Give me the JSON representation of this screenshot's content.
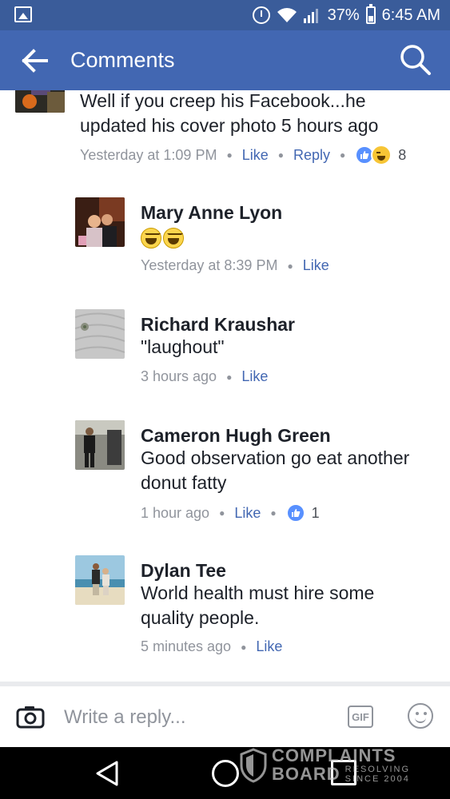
{
  "status_bar": {
    "battery": "37%",
    "time": "6:45 AM"
  },
  "app_bar": {
    "title": "Comments"
  },
  "comments": [
    {
      "name": "",
      "text_lines": [
        "Well if you creep his Facebook...he",
        "updated his cover photo 5 hours ago"
      ],
      "time": "Yesterday at 1:09 PM",
      "like": "Like",
      "reply": "Reply",
      "reactions": [
        "like",
        "haha"
      ],
      "reaction_count": "8"
    },
    {
      "name": "Mary Anne Lyon",
      "emojis": [
        "haha",
        "haha"
      ],
      "time": "Yesterday at 8:39 PM",
      "like": "Like"
    },
    {
      "name": "Richard Kraushar",
      "text_lines": [
        "\"laughout\""
      ],
      "time": "3 hours ago",
      "like": "Like"
    },
    {
      "name": "Cameron Hugh Green",
      "text_lines": [
        "Good observation go eat another",
        "donut fatty"
      ],
      "time": "1 hour ago",
      "like": "Like",
      "reactions": [
        "like"
      ],
      "reaction_count": "1"
    },
    {
      "name": "Dylan Tee",
      "text_lines": [
        "World health must hire some",
        "quality people."
      ],
      "time": "5 minutes ago",
      "like": "Like"
    }
  ],
  "composer": {
    "placeholder": "Write a reply...",
    "gif_label": "GIF"
  },
  "watermark": {
    "line1": "COMPLAINTS",
    "line2": "BOARD",
    "tag1": "RESOLVING",
    "tag2": "SINCE 2004"
  },
  "colors": {
    "status_bar": "#3a5c9a",
    "app_bar": "#4267b2",
    "link": "#4267b2",
    "meta_gray": "#90949c"
  }
}
